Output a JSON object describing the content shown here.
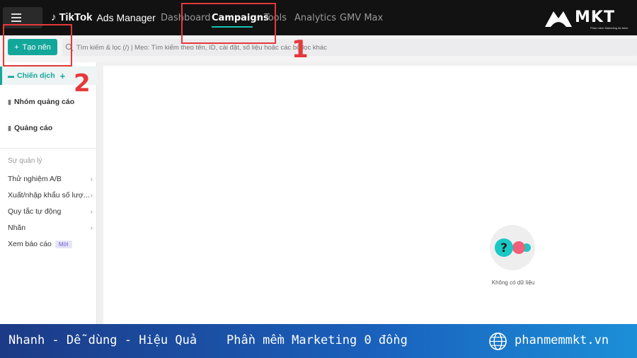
{
  "topnav": {
    "logo_brand": "TikTok",
    "logo_product": "Ads Manager",
    "items": [
      {
        "label": "Dashboard"
      },
      {
        "label": "Campaigns"
      },
      {
        "label": "Tools"
      },
      {
        "label": "Analytics"
      },
      {
        "label": "GMV Max"
      }
    ],
    "active": "Campaigns"
  },
  "brand": {
    "name": "MKT",
    "tagline": "Phần mềm Marketing đa kênh"
  },
  "toolbar": {
    "create_label": "Tạo nên",
    "search_placeholder": "Tìm kiếm & lọc (/) | Mẹo: Tìm kiếm theo tên, ID, cài đặt, số liệu hoặc các bộ lọc khác"
  },
  "sidebar": {
    "levels": [
      {
        "label": "Chiến dịch"
      },
      {
        "label": "Nhóm quảng cáo"
      },
      {
        "label": "Quảng cáo"
      }
    ],
    "section_title": "Sự quản lý",
    "links": [
      {
        "label": "Thử nghiệm A/B"
      },
      {
        "label": "Xuất/nhập khẩu số lượ..."
      },
      {
        "label": "Quy tắc tự động"
      },
      {
        "label": "Nhãn"
      },
      {
        "label": "Xem báo cáo",
        "badge": "Mới"
      }
    ]
  },
  "main": {
    "empty_text": "Không có dữ liệu"
  },
  "annotations": {
    "step1": "1",
    "step2": "2"
  },
  "footer": {
    "slogan": "Nhanh - Dễ dùng - Hiệu Quả",
    "tagline": "Phần mềm Marketing 0 đồng",
    "website": "phanmemmkt.vn"
  },
  "colors": {
    "accent": "#13a79b",
    "annotation": "#e5393b",
    "topbar": "#121212",
    "footer_start": "#1c3a86",
    "footer_end": "#1c8fd8"
  }
}
